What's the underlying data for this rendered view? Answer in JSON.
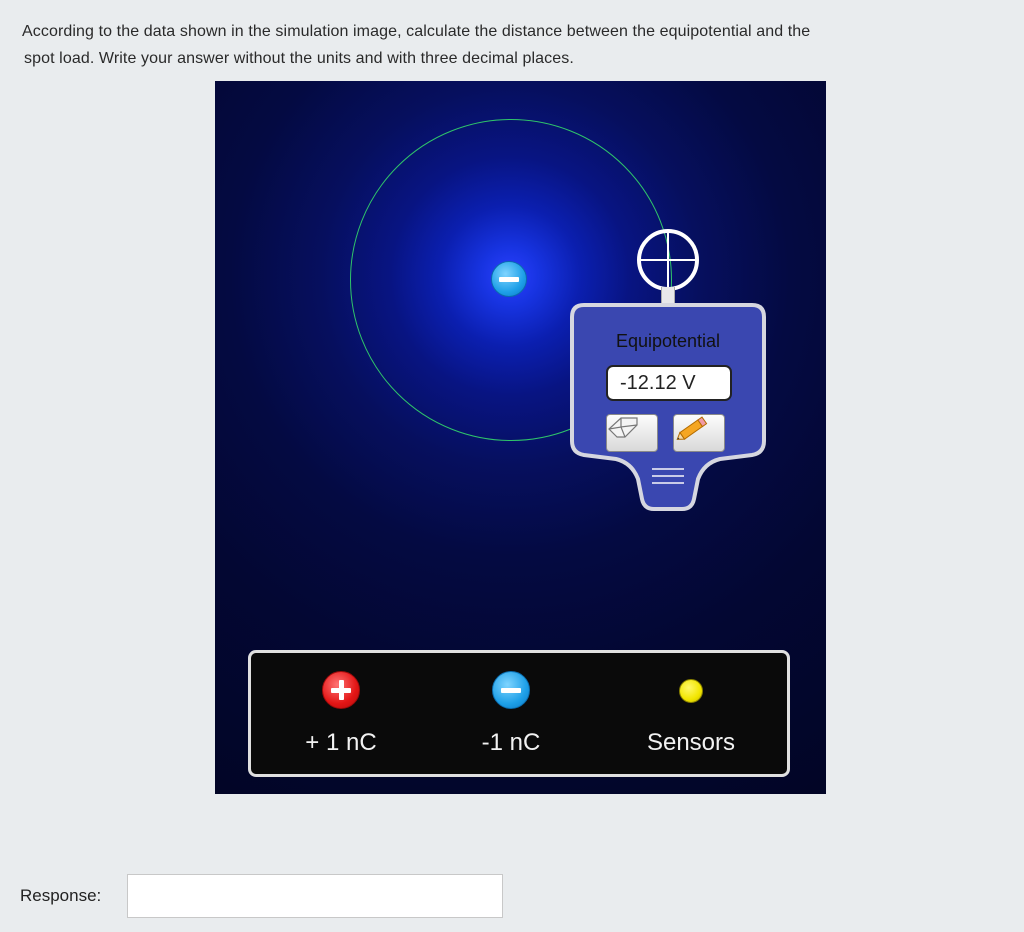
{
  "question": {
    "line1": "According to the data shown in the simulation image, calculate the distance between the equipotential and the",
    "line2": "spot load. Write your answer without the units and with three decimal places."
  },
  "sensor": {
    "title": "Equipotential",
    "voltage": "-12.12 V"
  },
  "toolbox": {
    "positive_label": "+ 1 nC",
    "negative_label": "-1 nC",
    "sensors_label": "Sensors"
  },
  "response": {
    "label": "Response:",
    "value": "",
    "placeholder": ""
  },
  "colors": {
    "equipotential_line": "#2fc46a",
    "negative_charge": "#1ea0e8",
    "positive_charge": "#e31515",
    "sensor": "#f2e600",
    "sensor_body": "#3a47b0"
  },
  "icons": {
    "eraser": "eraser-icon",
    "pencil": "pencil-icon",
    "crosshair": "crosshair-icon"
  }
}
